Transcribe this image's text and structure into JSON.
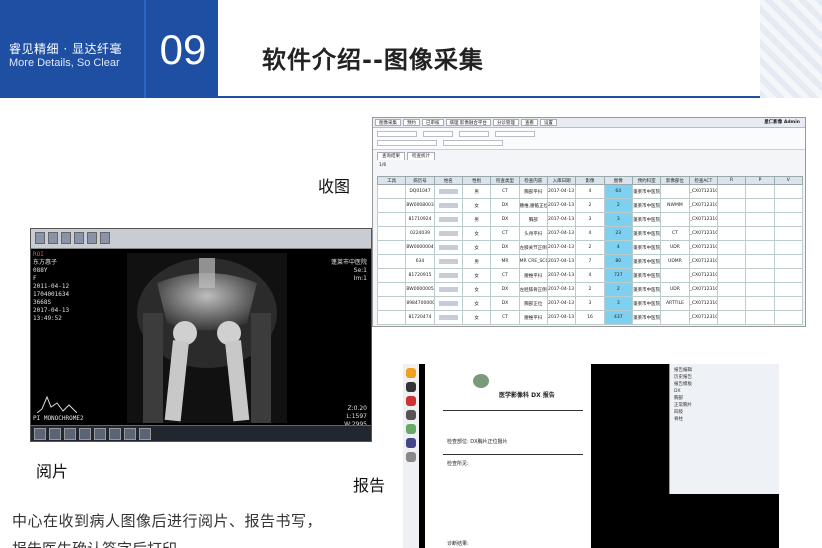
{
  "header": {
    "slogan_cn": "睿见精细 · 显达纤毫",
    "slogan_en": "More Details, So Clear",
    "section_number": "09",
    "title": "软件介绍--图像采集"
  },
  "captions": {
    "collect": "收图",
    "view": "阅片",
    "report": "报告"
  },
  "description": {
    "line1": "中心在收到病人图像后进行阅片、报告书写，",
    "line2": "报告医生确认签字后打印…"
  },
  "viewer": {
    "roi": "ROI",
    "patient_lines": [
      "东方惠子",
      "088Y",
      "F",
      "2011-04-12",
      "1704001634",
      "3668S",
      "2017-04-13",
      "13:49:52"
    ],
    "right_lines": [
      "蓬莱市中医院",
      "Se:1",
      "Im:1"
    ],
    "bottom_left": "PI MONOCHROME2",
    "bottom_right_lines": [
      "Z:0.20",
      "L:1597",
      "W:2995"
    ]
  },
  "collect": {
    "menu_tabs": [
      "图像采集",
      "预约",
      "已审核",
      "病理 影像融合平台",
      "分诊管理",
      "查看",
      "设置"
    ],
    "brand": "星仁影像 Admin",
    "sub_tabs": [
      "查询结果",
      "检查统计"
    ],
    "pager_text": "1/6",
    "columns": [
      "工具",
      "病历号",
      "姓名",
      "性别",
      "检查类型",
      "检查内容",
      "入库日期",
      "影像",
      "图像",
      "预约科室",
      "影像部位",
      "检查ACT",
      "R",
      "P",
      "V"
    ],
    "rows": [
      [
        "",
        "DQ01047",
        "",
        "男",
        "CT",
        "胸部平扫",
        "2017-04-13 14:15:12",
        "4",
        "64",
        "蓬莱市中医院",
        "",
        "_CX071231CN2927",
        "",
        "",
        ""
      ],
      [
        "",
        "BW0008003052",
        "",
        "女",
        "DX",
        "腰椎,腰骶正位",
        "2017-04-13 13:00:20",
        "2",
        "2",
        "蓬莱市中医院",
        "NWMM",
        "_CX071231CN3903",
        "",
        "",
        ""
      ],
      [
        "",
        "81710924",
        "",
        "男",
        "DX",
        "胸部",
        "2017-04-13 13:00:20",
        "3",
        "3",
        "蓬莱市中医院",
        "",
        "_CX071231CN4945",
        "",
        "",
        ""
      ],
      [
        "",
        "0224039",
        "",
        "女",
        "CT",
        "头颅平扫",
        "2017-04-13 15:06:29",
        "4",
        "23",
        "蓬莱市中医院",
        "CT",
        "_CX071231CN2681",
        "",
        "",
        ""
      ],
      [
        "",
        "BW0000004934",
        "",
        "女",
        "DX",
        "左膝关节正侧位",
        "2017-04-13 14:52:18",
        "2",
        "4",
        "蓬莱市中医院",
        "UDR",
        "_CX071231CN4942",
        "",
        "",
        ""
      ],
      [
        "",
        "634",
        "",
        "男",
        "MR",
        "MR CRE_SCOUT",
        "2017-04-13 15:00:02",
        "7",
        "80",
        "蓬莱市中医院",
        "UDMR",
        "_CX071231CN4945",
        "",
        "",
        ""
      ],
      [
        "",
        "81720915",
        "",
        "女",
        "CT",
        "腰椎平扫",
        "2017-04-13 14:52:03",
        "4",
        "727",
        "蓬莱市中医院",
        "",
        "_CX071231CN4945",
        "",
        "",
        ""
      ],
      [
        "",
        "BW0000005706",
        "",
        "女",
        "DX",
        "左胫腓骨正侧位",
        "2017-04-13 14:52:12",
        "2",
        "2",
        "蓬莱市中医院",
        "UDR",
        "_CX071231CN4942",
        "",
        "",
        ""
      ],
      [
        "",
        "8984700000747",
        "",
        "女",
        "DX",
        "胸部正位",
        "2017-04-13 14:50:18",
        "3",
        "3",
        "蓬莱市中医院",
        "ARTTILE",
        "_CX071231CN4891",
        "",
        "",
        ""
      ],
      [
        "",
        "81720474",
        "",
        "女",
        "CT",
        "腰椎平扫",
        "2017-04-13 14:59:23",
        "16",
        "437",
        "蓬莱市中医院",
        "",
        "_CX071231CN4945",
        "",
        "",
        ""
      ]
    ]
  },
  "report": {
    "title": "医学影像科 DX 报告",
    "exam_label": "检查部位:",
    "exam_value": "DX胸片正位摄片",
    "findings_label": "检查所见:",
    "impression_label": "诊断结果:",
    "panel_items": [
      "报告编辑",
      "历史报告",
      "报告模板",
      "DX",
      "胸部",
      "正常胸片",
      "四肢",
      "脊柱"
    ]
  }
}
